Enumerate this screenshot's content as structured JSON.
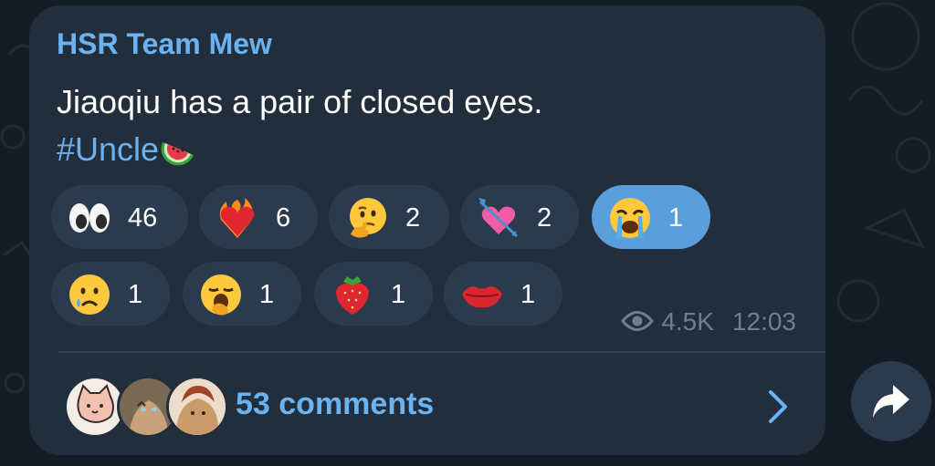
{
  "message": {
    "channel_name": "HSR Team Mew",
    "text_line1": "Jiaoqiu has a pair of closed eyes.",
    "hashtag": "#Uncle",
    "hashtag_emoji_icon": "watermelon-icon",
    "views": "4.5K",
    "time": "12:03",
    "views_icon": "eye-icon"
  },
  "reactions": [
    {
      "icon": "eyes-emoji",
      "count": "46",
      "selected": false
    },
    {
      "icon": "heart-on-fire-emoji",
      "count": "6",
      "selected": false
    },
    {
      "icon": "thinking-face-emoji",
      "count": "2",
      "selected": false
    },
    {
      "icon": "heart-with-arrow-emoji",
      "count": "2",
      "selected": false
    },
    {
      "icon": "loudly-crying-face-emoji",
      "count": "1",
      "selected": true
    },
    {
      "icon": "crying-face-emoji",
      "count": "1",
      "selected": false
    },
    {
      "icon": "yawning-face-emoji",
      "count": "1",
      "selected": false
    },
    {
      "icon": "strawberry-emoji",
      "count": "1",
      "selected": false
    },
    {
      "icon": "kiss-mark-emoji",
      "count": "1",
      "selected": false
    }
  ],
  "comments": {
    "label": "53 comments",
    "avatars": [
      "cat-cartoon-avatar",
      "tabby-cat-avatar",
      "anime-character-avatar"
    ]
  },
  "colors": {
    "accent": "#6ab3f3",
    "bubble": "#232e3c",
    "reaction_bg": "#2b3a4d",
    "reaction_selected_bg": "#5a9edb",
    "background": "#141c25"
  }
}
